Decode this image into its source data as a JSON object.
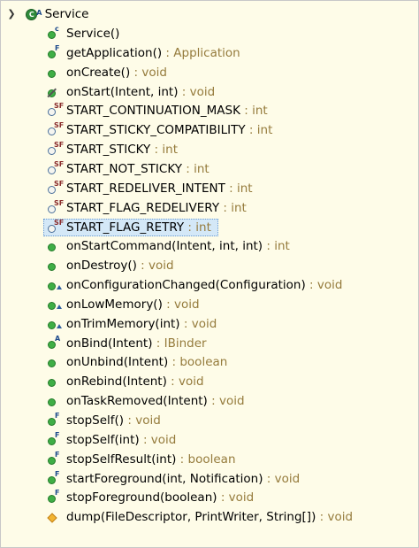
{
  "root": {
    "label": "Service",
    "icon": "class-icon",
    "modifier": "A"
  },
  "members": [
    {
      "name": "Service()",
      "type": "",
      "icon": "public-method-icon",
      "mod": "c"
    },
    {
      "name": "getApplication()",
      "type": " : Application",
      "icon": "public-method-icon",
      "mod": "F"
    },
    {
      "name": "onCreate()",
      "type": " : void",
      "icon": "public-method-icon",
      "mod": ""
    },
    {
      "name": "onStart(Intent, int)",
      "type": " : void",
      "icon": "deprecated-method-icon",
      "mod": ""
    },
    {
      "name": "START_CONTINUATION_MASK",
      "type": " : int",
      "icon": "static-final-field-icon",
      "mod": "SF"
    },
    {
      "name": "START_STICKY_COMPATIBILITY",
      "type": " : int",
      "icon": "static-final-field-icon",
      "mod": "SF"
    },
    {
      "name": "START_STICKY",
      "type": " : int",
      "icon": "static-final-field-icon",
      "mod": "SF"
    },
    {
      "name": "START_NOT_STICKY",
      "type": " : int",
      "icon": "static-final-field-icon",
      "mod": "SF"
    },
    {
      "name": "START_REDELIVER_INTENT",
      "type": " : int",
      "icon": "static-final-field-icon",
      "mod": "SF"
    },
    {
      "name": "START_FLAG_REDELIVERY",
      "type": " : int",
      "icon": "static-final-field-icon",
      "mod": "SF"
    },
    {
      "name": "START_FLAG_RETRY",
      "type": " : int",
      "icon": "static-final-field-icon",
      "mod": "SF",
      "selected": true
    },
    {
      "name": "onStartCommand(Intent, int, int)",
      "type": " : int",
      "icon": "public-method-icon",
      "mod": ""
    },
    {
      "name": "onDestroy()",
      "type": " : void",
      "icon": "public-method-icon",
      "mod": ""
    },
    {
      "name": "onConfigurationChanged(Configuration)",
      "type": " : void",
      "icon": "implements-method-icon",
      "mod": ""
    },
    {
      "name": "onLowMemory()",
      "type": " : void",
      "icon": "implements-method-icon",
      "mod": ""
    },
    {
      "name": "onTrimMemory(int)",
      "type": " : void",
      "icon": "implements-method-icon",
      "mod": ""
    },
    {
      "name": "onBind(Intent)",
      "type": " : IBinder",
      "icon": "abstract-method-icon",
      "mod": "A"
    },
    {
      "name": "onUnbind(Intent)",
      "type": " : boolean",
      "icon": "public-method-icon",
      "mod": ""
    },
    {
      "name": "onRebind(Intent)",
      "type": " : void",
      "icon": "public-method-icon",
      "mod": ""
    },
    {
      "name": "onTaskRemoved(Intent)",
      "type": " : void",
      "icon": "public-method-icon",
      "mod": ""
    },
    {
      "name": "stopSelf()",
      "type": " : void",
      "icon": "public-method-icon",
      "mod": "F"
    },
    {
      "name": "stopSelf(int)",
      "type": " : void",
      "icon": "public-method-icon",
      "mod": "F"
    },
    {
      "name": "stopSelfResult(int)",
      "type": " : boolean",
      "icon": "public-method-icon",
      "mod": "F"
    },
    {
      "name": "startForeground(int, Notification)",
      "type": " : void",
      "icon": "public-method-icon",
      "mod": "F"
    },
    {
      "name": "stopForeground(boolean)",
      "type": " : void",
      "icon": "public-method-icon",
      "mod": "F"
    },
    {
      "name": "dump(FileDescriptor, PrintWriter, String[])",
      "type": " : void",
      "icon": "protected-method-icon",
      "mod": ""
    }
  ],
  "colors": {
    "background": "#fefce8",
    "return_type": "#957b3c",
    "selection": "#d4e8f7",
    "method_dot": "#3fae45"
  }
}
